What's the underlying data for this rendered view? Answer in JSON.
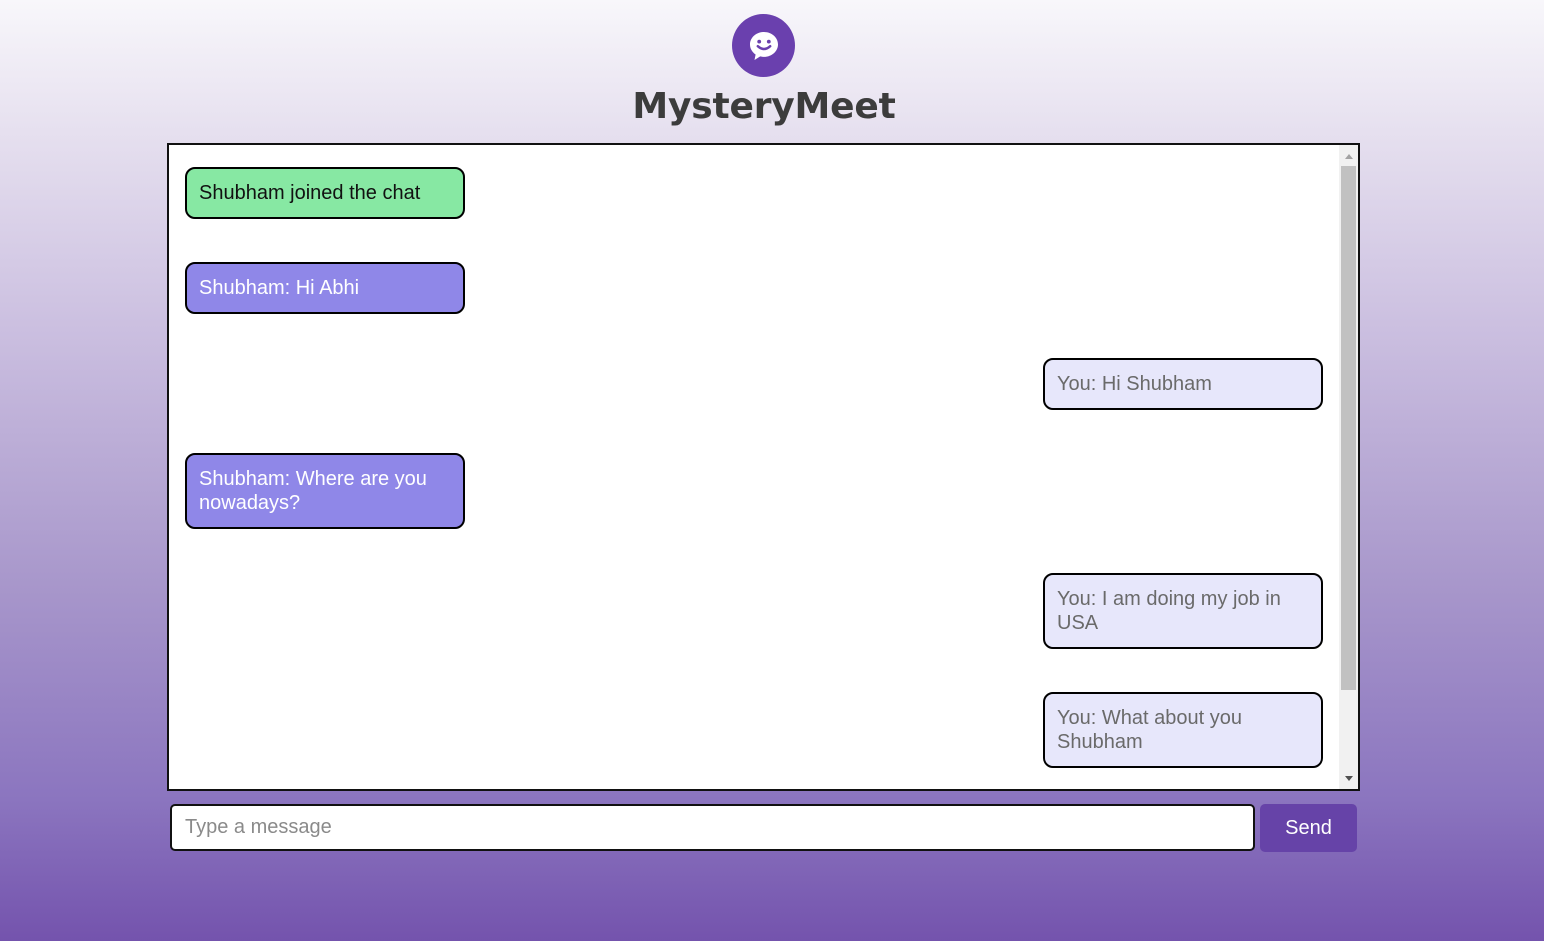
{
  "app": {
    "title": "MysteryMeet",
    "logo_icon": "chat-bubble-smile-icon",
    "brand_color": "#6a40ae"
  },
  "messages": [
    {
      "type": "system",
      "align": "left",
      "text": "Shubham joined the chat"
    },
    {
      "type": "incoming",
      "align": "left",
      "text": "Shubham: Hi Abhi"
    },
    {
      "type": "outgoing",
      "align": "right",
      "text": "You: Hi Shubham"
    },
    {
      "type": "incoming",
      "align": "left",
      "text": "Shubham: Where are you nowadays?"
    },
    {
      "type": "outgoing",
      "align": "right",
      "text": "You: I am doing my job in USA"
    },
    {
      "type": "outgoing",
      "align": "right",
      "text": "You: What about you Shubham"
    }
  ],
  "composer": {
    "placeholder": "Type a message",
    "value": "",
    "send_label": "Send"
  },
  "colors": {
    "system_bubble": "#87e8a3",
    "incoming_bubble": "#8f87e8",
    "outgoing_bubble": "#e7e7fb",
    "send_button": "#6643a8"
  }
}
